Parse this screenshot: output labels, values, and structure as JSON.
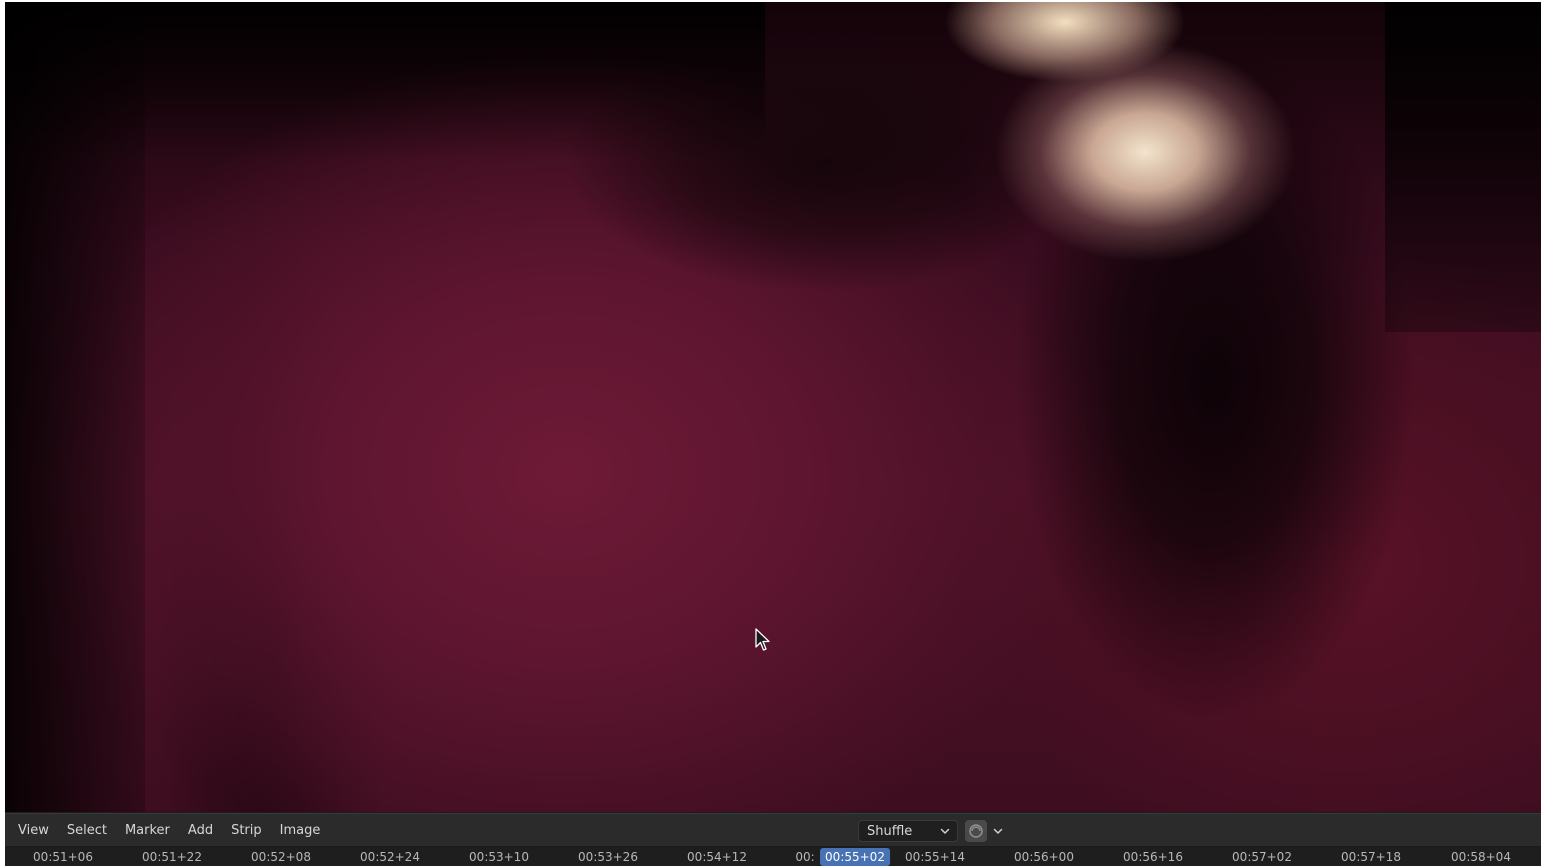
{
  "header": {
    "menus": [
      "View",
      "Select",
      "Marker",
      "Add",
      "Strip",
      "Image"
    ],
    "proxy_dropdown": {
      "selected": "Shuffle"
    }
  },
  "timeline": {
    "ticks": [
      "00:51+06",
      "00:51+22",
      "00:52+08",
      "00:52+24",
      "00:53+10",
      "00:53+26",
      "00:54+12",
      "00:",
      "00:55+14",
      "00:56+00",
      "00:56+16",
      "00:57+02",
      "00:57+18",
      "00:58+04"
    ],
    "current_frame": "00:55+02"
  },
  "colors": {
    "accent": "#4772b3",
    "header_bg": "#2b2b2b",
    "ruler_bg": "#1e1e1e"
  },
  "icons": {
    "cursor": "mouse-pointer-icon",
    "dropdown": "chevron-down-icon",
    "overlay": "overlay-icon"
  }
}
